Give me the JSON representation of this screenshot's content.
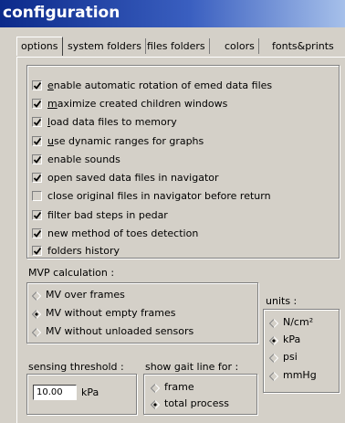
{
  "window": {
    "title": "configuration"
  },
  "tabs": [
    {
      "label": "options",
      "active": true
    },
    {
      "label": "system folders",
      "active": false
    },
    {
      "label": "files folders",
      "active": false
    },
    {
      "label": "colors",
      "active": false
    },
    {
      "label": "fonts&prints",
      "active": false
    }
  ],
  "options": [
    {
      "label": "enable automatic rotation of emed data files",
      "checked": true
    },
    {
      "label": "maximize created children windows",
      "checked": true
    },
    {
      "label": "load data files to memory",
      "checked": true
    },
    {
      "label": "use dynamic ranges for graphs",
      "checked": true
    },
    {
      "label": "enable sounds",
      "checked": true
    },
    {
      "label": "open saved data files in navigator",
      "checked": true
    },
    {
      "label": "close original files in navigator before return",
      "checked": false
    },
    {
      "label": "filter bad steps in pedar",
      "checked": true
    },
    {
      "label": "new method of toes detection",
      "checked": true
    },
    {
      "label": "folders history",
      "checked": true
    }
  ],
  "mvp": {
    "label": "MVP calculation :",
    "options": [
      {
        "label": "MV over frames",
        "selected": false
      },
      {
        "label": "MV without empty frames",
        "selected": true
      },
      {
        "label": "MV without unloaded sensors",
        "selected": false
      }
    ]
  },
  "units": {
    "label": "units :",
    "options": [
      {
        "label": "N/cm²",
        "selected": false
      },
      {
        "label": "kPa",
        "selected": true
      },
      {
        "label": "psi",
        "selected": false
      },
      {
        "label": "mmHg",
        "selected": false
      }
    ]
  },
  "threshold": {
    "label": "sensing threshold :",
    "value": "10.00",
    "unit": "kPa"
  },
  "gait": {
    "label": "show gait line for :",
    "options": [
      {
        "label": "frame",
        "selected": false
      },
      {
        "label": "total process",
        "selected": true
      }
    ]
  }
}
